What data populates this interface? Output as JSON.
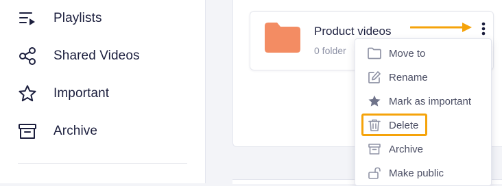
{
  "sidebar": {
    "items": [
      {
        "label": "Playlists",
        "icon": "playlist-icon"
      },
      {
        "label": "Shared Videos",
        "icon": "share-icon"
      },
      {
        "label": "Important",
        "icon": "star-icon"
      },
      {
        "label": "Archive",
        "icon": "archive-icon"
      }
    ]
  },
  "folder": {
    "title": "Product videos",
    "meta": "0 folder",
    "color": "#f38c63"
  },
  "menu": {
    "items": [
      {
        "label": "Move to",
        "icon": "folder-icon"
      },
      {
        "label": "Rename",
        "icon": "edit-icon"
      },
      {
        "label": "Mark as important",
        "icon": "star-filled-icon"
      },
      {
        "label": "Delete",
        "icon": "trash-icon"
      },
      {
        "label": "Archive",
        "icon": "archive-icon"
      },
      {
        "label": "Make public",
        "icon": "unlock-icon"
      }
    ]
  },
  "colors": {
    "accent": "#f5a30a",
    "text": "#1b1e3d",
    "menu_text": "#4a4d63",
    "icon_gray": "#8f93a5"
  }
}
